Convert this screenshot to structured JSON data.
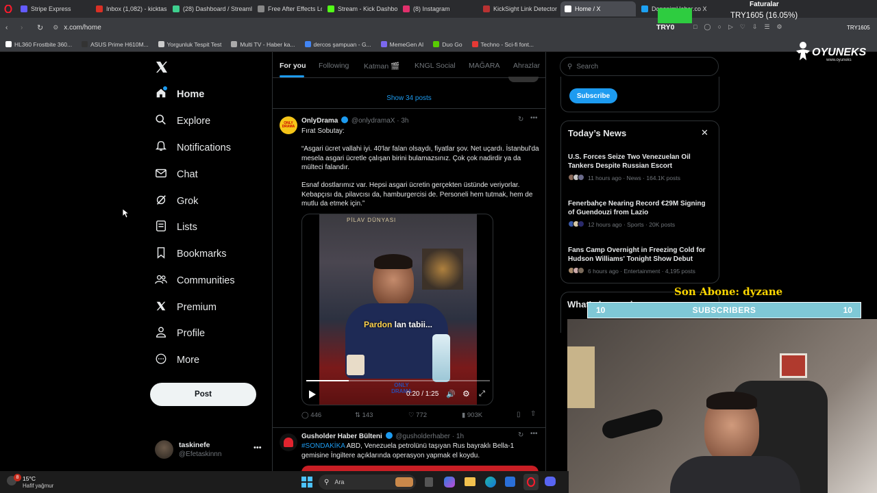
{
  "browser": {
    "tabs": [
      {
        "label": "Stripe Express",
        "color": "#635bff"
      },
      {
        "label": "Inbox (1,082) - kicktaskine",
        "color": "#d93025"
      },
      {
        "label": "(28) Dashboard / Streamla",
        "color": "#3ecf8e"
      },
      {
        "label": "Free After Effects Lower T",
        "color": "#888888"
      },
      {
        "label": "Stream - Kick Dashboard",
        "color": "#53fc18"
      },
      {
        "label": "(8) Instagram",
        "color": "#e1306c"
      },
      {
        "label": "KickSight Link Detector",
        "color": "#b83232"
      },
      {
        "label": "Home / X",
        "color": "#ffffff"
      },
      {
        "label": "DonanimHaber.co X ",
        "color": "#1da1f2"
      }
    ],
    "url": "x.com/home",
    "bookmarks": [
      {
        "label": "HL360 Frostbite 360...",
        "color": "#ffffff"
      },
      {
        "label": "ASUS Prime H610M...",
        "color": "#333333"
      },
      {
        "label": "Yorgunluk Tespit Test",
        "color": "#cccccc"
      },
      {
        "label": "Multi TV - Haber ka...",
        "color": "#aaaaaa"
      },
      {
        "label": "dercos şampuan - G...",
        "color": "#4285f4"
      },
      {
        "label": "MemeGen AI",
        "color": "#7b68ee"
      },
      {
        "label": "Duo Go",
        "color": "#58cc02"
      },
      {
        "label": "Techno - Sci-fi font...",
        "color": "#e53935"
      }
    ]
  },
  "overlay": {
    "faturalar": "Faturalar",
    "currency": "TRY1605 (16.05%)",
    "try0": "TRY0",
    "try_right": "TRY1605",
    "brand": "OYUNEKS",
    "brand_sub": "www.oyuneks",
    "last_sub": "Son Abone: dyzane",
    "subs_left": "10",
    "subs_label": "SUBSCRIBERS",
    "subs_right": "10"
  },
  "sidebar": {
    "items": [
      {
        "label": "Home",
        "icon": "home-icon"
      },
      {
        "label": "Explore",
        "icon": "search-icon"
      },
      {
        "label": "Notifications",
        "icon": "bell-icon"
      },
      {
        "label": "Chat",
        "icon": "mail-icon"
      },
      {
        "label": "Grok",
        "icon": "grok-icon"
      },
      {
        "label": "Lists",
        "icon": "list-icon"
      },
      {
        "label": "Bookmarks",
        "icon": "bookmark-icon"
      },
      {
        "label": "Communities",
        "icon": "people-icon"
      },
      {
        "label": "Premium",
        "icon": "x-icon"
      },
      {
        "label": "Profile",
        "icon": "person-icon"
      },
      {
        "label": "More",
        "icon": "more-icon"
      }
    ],
    "post_button": "Post",
    "user": {
      "name": "taskinefe",
      "handle": "@Efetaskinnn"
    }
  },
  "feed": {
    "tabs": [
      "For you",
      "Following",
      "Katman 🎬",
      "KNGL Social",
      "MAĞARA",
      "Ahrazlar"
    ],
    "show_posts": "Show 34 posts",
    "tweet1": {
      "name": "OnlyDrama",
      "handle": "@onlydramaX",
      "time": "· 3h",
      "line1": "Fırat Sobutay:",
      "para1": "“Asgari ücret vallahi iyi. 40'lar falan olsaydı, fiyatlar şov. Net uçardı. İstanbul'da mesela asgari ücretle çalışan birini bulamazsınız. Çok çok nadirdir ya da mülteci falandır.",
      "para2": "Esnaf dostlarımız var. Hepsi asgari ücretin gerçekten üstünde veriyorlar. Kebapçısı da, pilavcısı da, hamburgercisi de. Personeli hem tutmak, hem de mutlu da etmek için.”",
      "video_caption_a": "Pardon",
      "video_caption_b": " lan tabii...",
      "video_time": "0:20 / 1:25",
      "video_sign": "PİLAV DÜNYASI",
      "watermark": "ONLY DRAMA",
      "replies": "446",
      "reposts": "143",
      "likes": "772",
      "views": "903K"
    },
    "tweet2": {
      "name": "Gusholder Haber Bülteni",
      "handle": "@gusholderhaber",
      "time": "· 1h",
      "hashtag": "#SONDAKİKA",
      "text": " ABD, Venezuela petrolünü taşıyan Rus bayraklı Bella-1 gemisine İngiltere açıklarında operasyon yapmak el koydu."
    }
  },
  "right": {
    "search_placeholder": "Search",
    "subscribe": "Subscribe",
    "news_header": "Today’s News",
    "news": [
      {
        "title": "U.S. Forces Seize Two Venezuelan Oil Tankers Despite Russian Escort",
        "meta": "11 hours ago · News · 164.1K posts"
      },
      {
        "title": "Fenerbahçe Nearing Record €29M Signing of Guendouzi from Lazio",
        "meta": "12 hours ago · Sports · 20K posts"
      },
      {
        "title": "Fans Camp Overnight in Freezing Cold for Hudson Williams' Tonight Show Debut",
        "meta": "6 hours ago · Entertainment · 4,195 posts"
      }
    ],
    "whats_happening": "What's happening"
  },
  "taskbar": {
    "temp": "15°C",
    "weather": "Hafif yağmur",
    "search": "Ara",
    "badge": "8"
  },
  "colors": {
    "accent": "#1d9bf0",
    "gold": "#ffd700",
    "subs_bar": "#7fc8d6"
  }
}
